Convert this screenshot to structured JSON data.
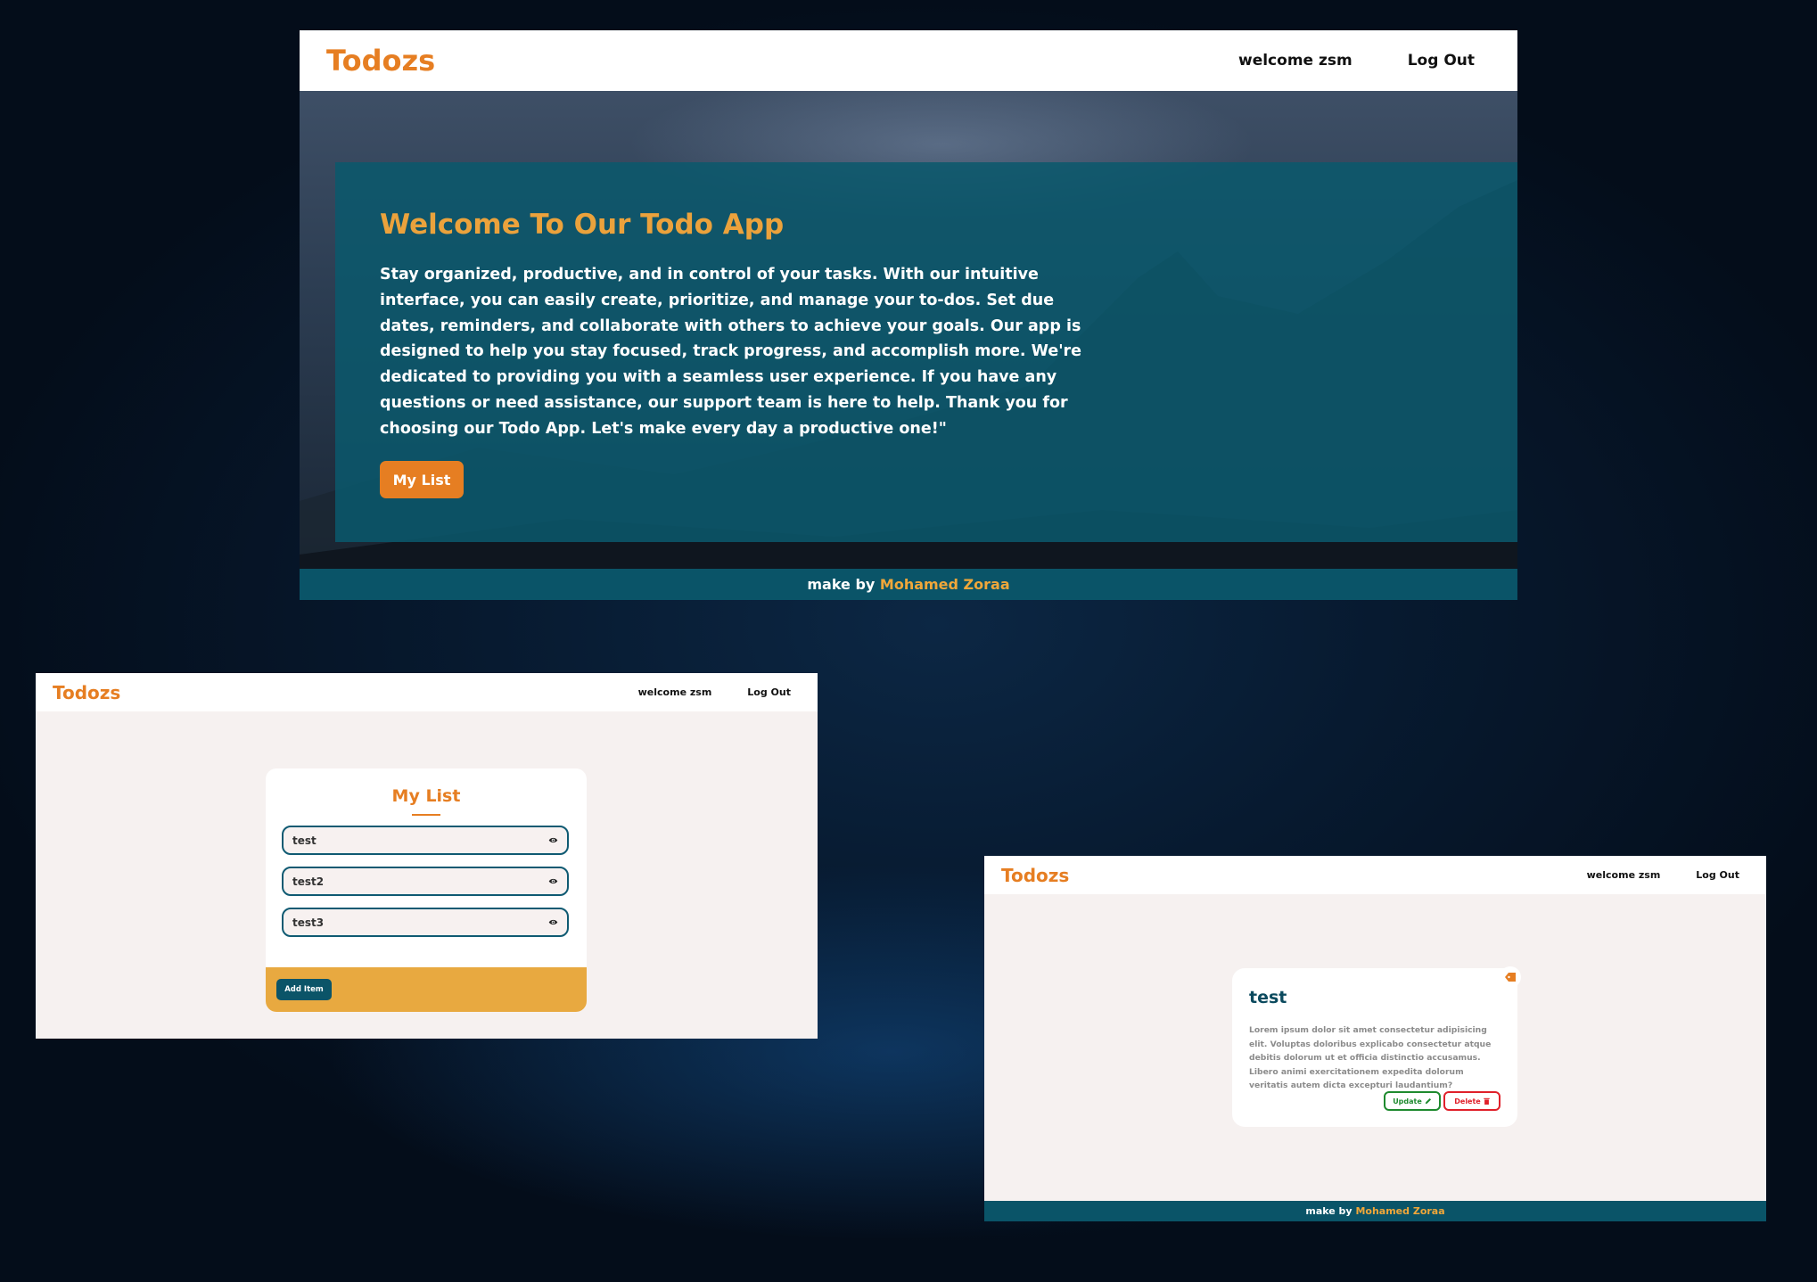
{
  "brand": "Todozs",
  "nav": {
    "welcome": "welcome zsm",
    "logout": "Log Out"
  },
  "footer": {
    "prefix": "make by",
    "author": "Mohamed Zoraa"
  },
  "home": {
    "title": "Welcome To Our Todo App",
    "description": "Stay organized, productive, and in control of your tasks. With our intuitive interface, you can easily create, prioritize, and manage your to-dos. Set due dates, reminders, and collaborate with others to achieve your goals. Our app is designed to help you stay focused, track progress, and accomplish more. We're dedicated to providing you with a seamless user experience. If you have any questions or need assistance, our support team is here to help. Thank you for choosing our Todo App. Let's make every day a productive one!\"",
    "button": "My List"
  },
  "list": {
    "title": "My List",
    "items": [
      {
        "label": "test"
      },
      {
        "label": "test2"
      },
      {
        "label": "test3"
      }
    ],
    "add_button": "Add Item"
  },
  "detail": {
    "title": "test",
    "description": "Lorem ipsum dolor sit amet consectetur adipisicing elit. Voluptas doloribus explicabo consectetur atque debitis dolorum ut et officia distinctio accusamus. Libero animi exercitationem expedita dolorum veritatis autem dicta excepturi laudantium?",
    "update_button": "Update",
    "delete_button": "Delete"
  },
  "colors": {
    "brand": "#e67e22",
    "accent": "#eba23c",
    "teal": "#0b5468",
    "update": "#1e8a2e",
    "delete": "#e0202a"
  },
  "icons": [
    "eye-icon",
    "pencil-icon",
    "trash-icon",
    "tag-icon"
  ]
}
